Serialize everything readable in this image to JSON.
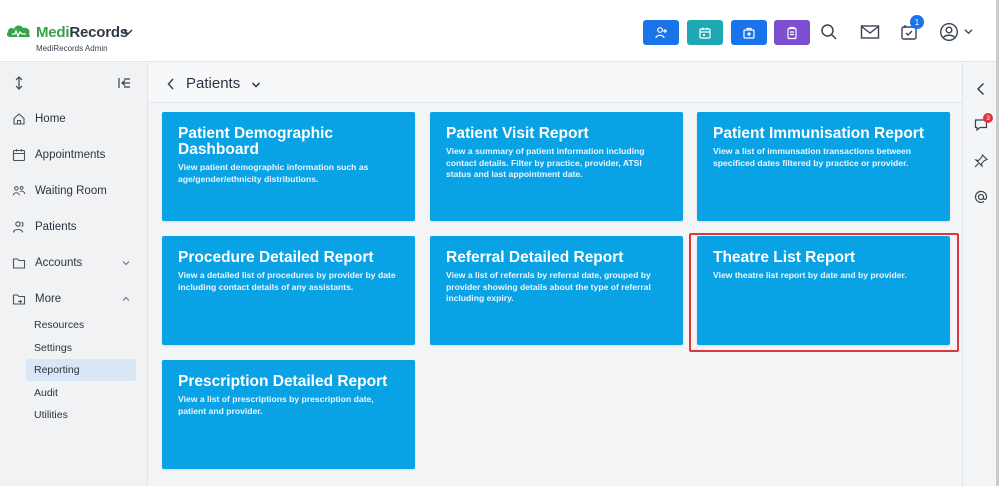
{
  "app": {
    "brand_part1": "Medi",
    "brand_part2": "Records",
    "subtitle": "MediRecords Admin"
  },
  "header": {
    "actions": [
      {
        "icon": "add-patient-icon",
        "color": "#1a73e8"
      },
      {
        "icon": "calendar-icon",
        "color": "#1fa8b3"
      },
      {
        "icon": "medical-kit-icon",
        "color": "#1a73e8"
      },
      {
        "icon": "clipboard-icon",
        "color": "#7b4fcf"
      }
    ],
    "tasks_badge": "1"
  },
  "sidebar": {
    "items": [
      {
        "label": "Home",
        "icon": "home-icon"
      },
      {
        "label": "Appointments",
        "icon": "calendar-icon"
      },
      {
        "label": "Waiting Room",
        "icon": "waiting-room-icon"
      },
      {
        "label": "Patients",
        "icon": "patients-icon"
      },
      {
        "label": "Accounts",
        "icon": "folder-icon"
      },
      {
        "label": "More",
        "icon": "folder-share-icon"
      }
    ],
    "subitems": [
      {
        "label": "Resources"
      },
      {
        "label": "Settings"
      },
      {
        "label": "Reporting",
        "active": true
      },
      {
        "label": "Audit"
      },
      {
        "label": "Utilities"
      }
    ]
  },
  "main": {
    "title": "Patients",
    "cards": [
      {
        "title": "Patient Demographic Dashboard",
        "description": "View patient demographic information such as age/gender/ethnicity distributions."
      },
      {
        "title": "Patient Visit Report",
        "description": "View a summary of patient information including contact details. Filter by practice, provider, ATSI status and last appointment date."
      },
      {
        "title": "Patient Immunisation Report",
        "description": "View a list of immunsation transactions between specificed dates filtered by practice or provider."
      },
      {
        "title": "Procedure Detailed Report",
        "description": "View a detailed list of procedures by provider by date including contact details of any assistants."
      },
      {
        "title": "Referral Detailed Report",
        "description": "View a list of referrals by referral date, grouped by provider showing details about the type of referral including expiry."
      },
      {
        "title": "Theatre List Report",
        "description": "View theatre list report by date and by provider.",
        "highlighted": true
      },
      {
        "title": "Prescription Detailed Report",
        "description": "View a list of prescriptions by prescription date, patient and provider."
      }
    ]
  },
  "rail": {
    "comments_badge": "3"
  },
  "colors": {
    "card": "#09a3e5",
    "highlight": "#e0353b",
    "brand_green": "#35a04a"
  }
}
